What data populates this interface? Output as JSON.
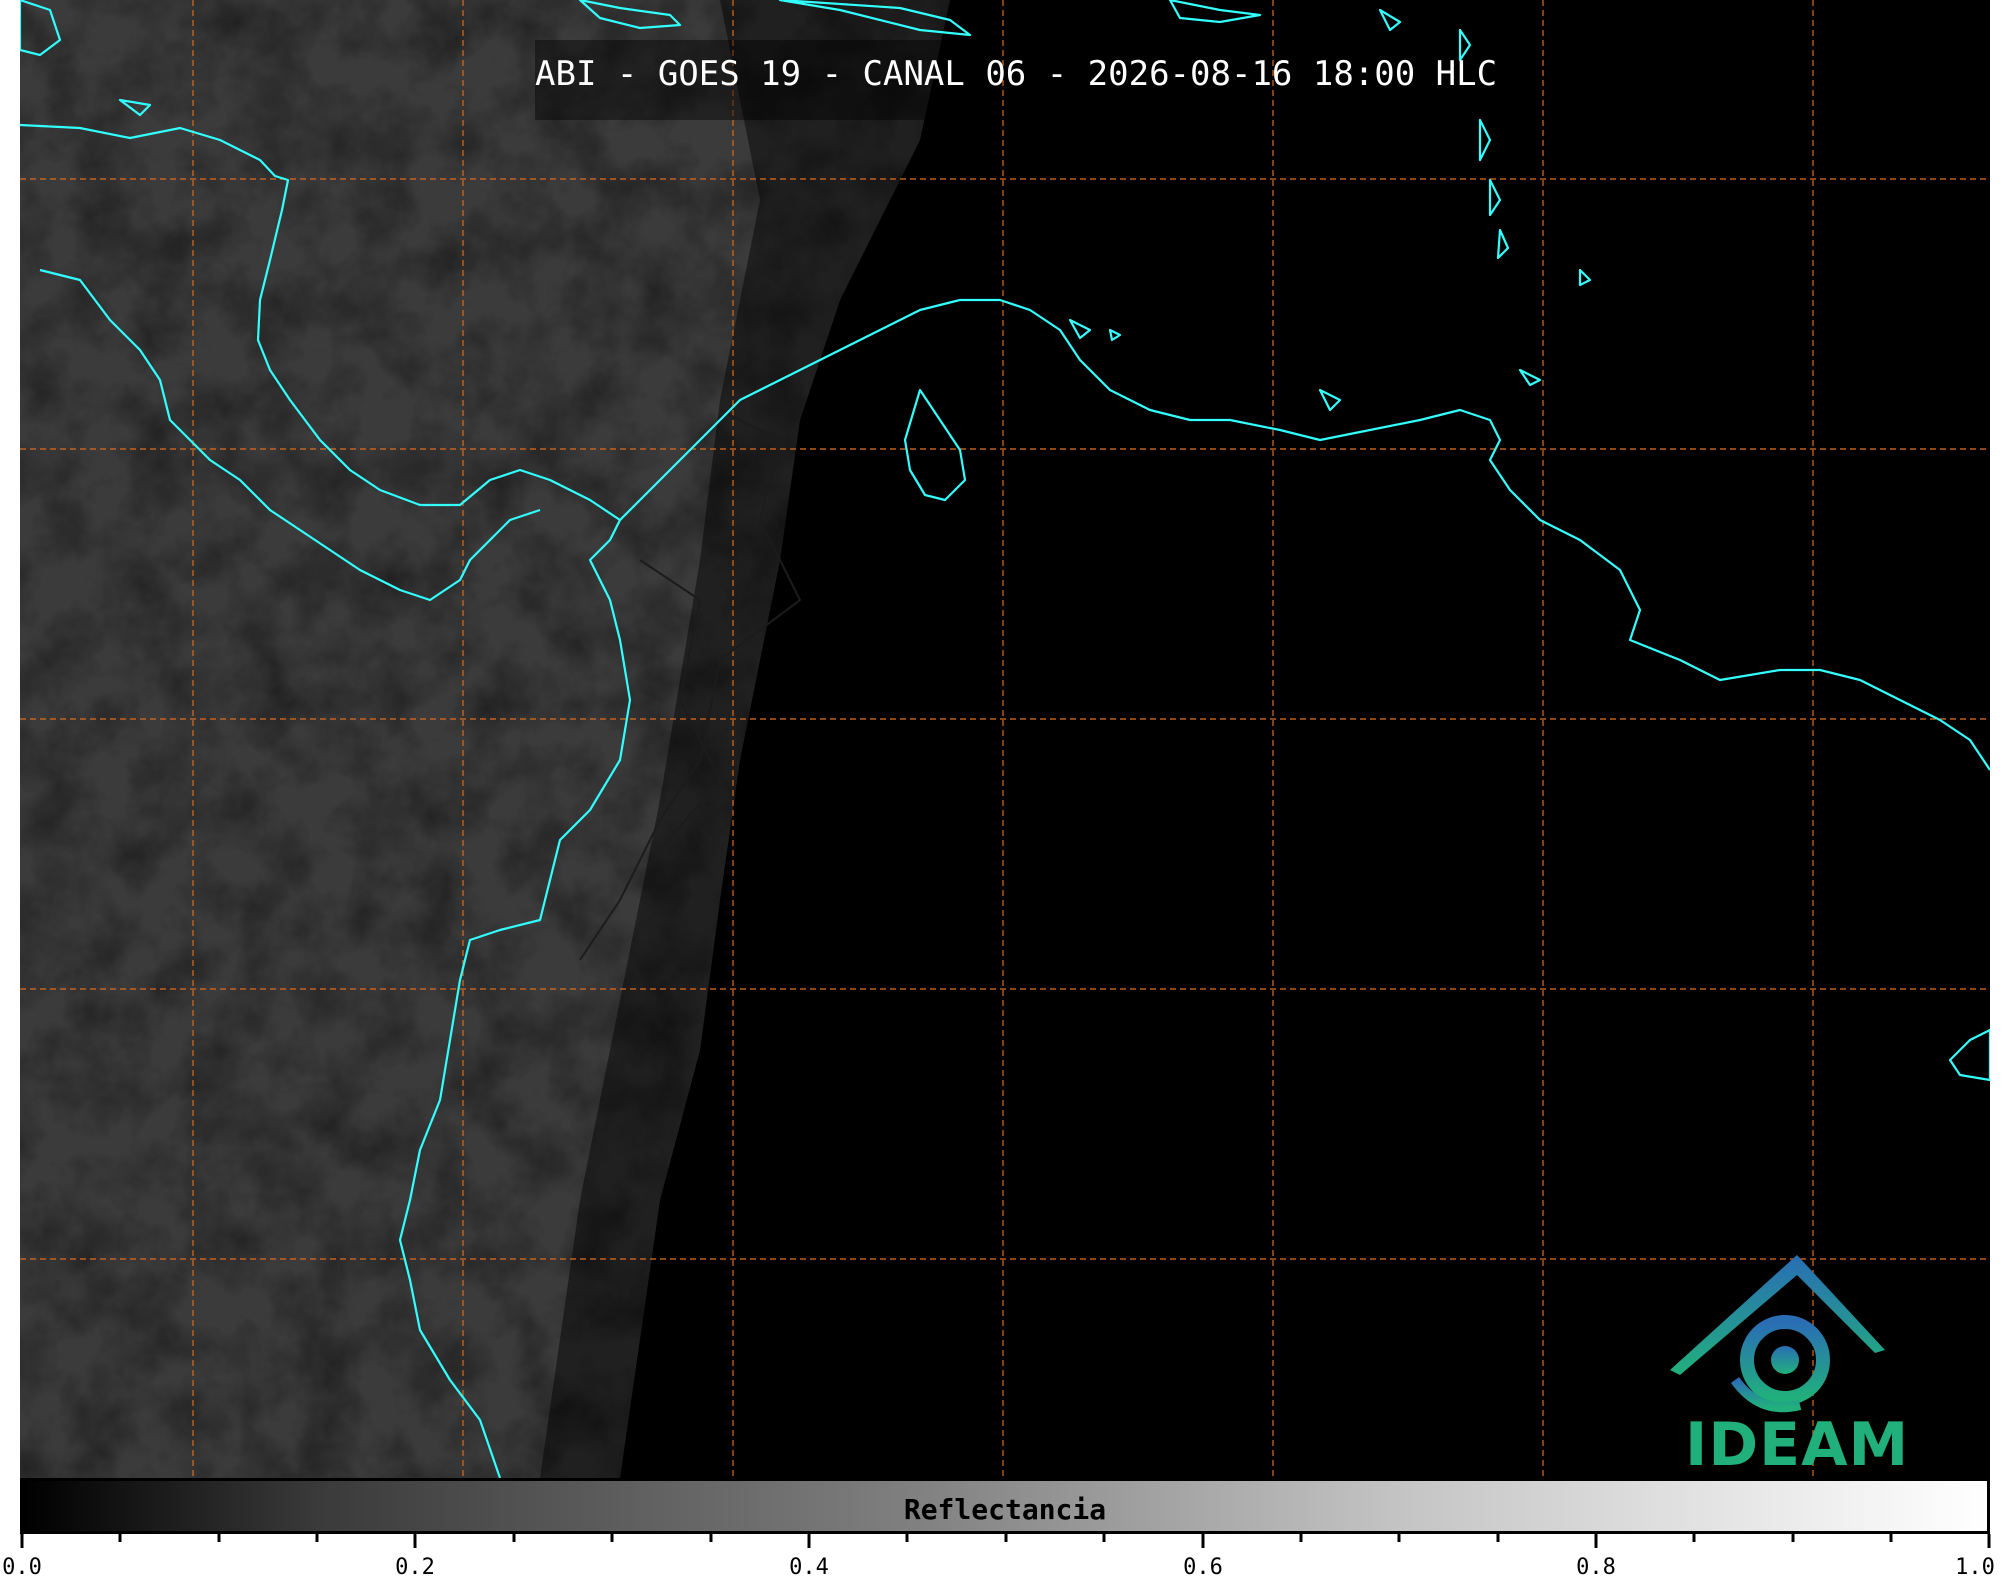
{
  "title": "ABI - GOES 19 - CANAL 06 - 2026-08-16 18:00 HLC",
  "colorbar": {
    "label": "Reflectancia",
    "range": [
      0.0,
      1.0
    ],
    "tick_labels": [
      "0.0",
      "0.2",
      "0.4",
      "0.6",
      "0.8",
      "1.0"
    ],
    "colormap": [
      "#000000",
      "#ffffff"
    ]
  },
  "logo": {
    "name": "IDEAM",
    "colors": [
      "#2a6db5",
      "#21b07c"
    ]
  },
  "map_style": {
    "background": "#000000",
    "coastline_color": "#33ffff",
    "grid_color": "#d2691e",
    "border_color": "#222222"
  }
}
